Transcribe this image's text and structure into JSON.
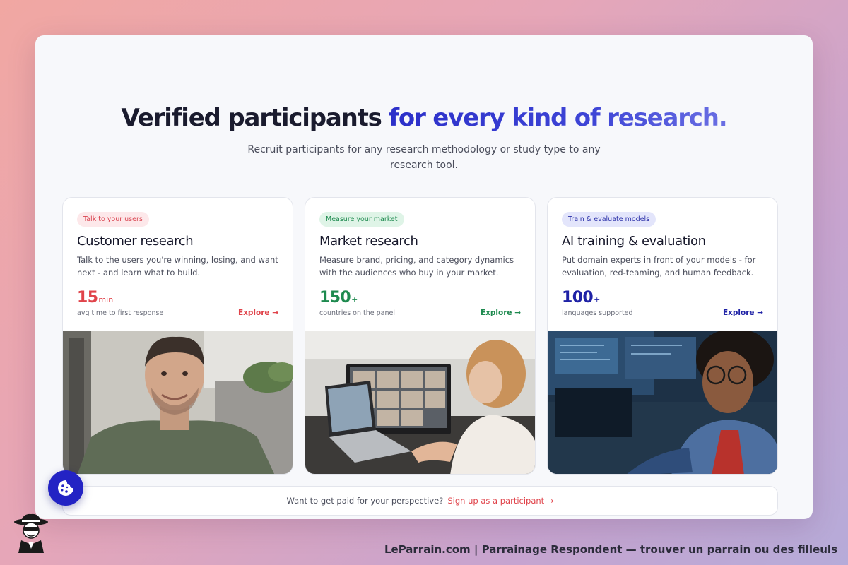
{
  "headline": {
    "part1": "Verified participants ",
    "accent": "for every kind of research."
  },
  "subhead": "Recruit participants for any research methodology or study type to any research tool.",
  "cards": [
    {
      "tag": "Talk to your users",
      "title": "Customer research",
      "description": "Talk to the users you're winning, losing, and want next - and learn what to build.",
      "stat_value": "15",
      "stat_unit": "min",
      "stat_label": "avg time to first response",
      "link": "Explore →",
      "accent_color": "#e0434a"
    },
    {
      "tag": "Measure your market",
      "title": "Market research",
      "description": "Measure brand, pricing, and category dynamics with the audiences who buy in your market.",
      "stat_value": "150",
      "stat_unit": "+",
      "stat_label": "countries on the panel",
      "link": "Explore →",
      "accent_color": "#1e8a4f"
    },
    {
      "tag": "Train & evaluate models",
      "title": "AI training & evaluation",
      "description": "Put domain experts in front of your models - for evaluation, red-teaming, and human feedback.",
      "stat_value": "100",
      "stat_unit": "+",
      "stat_label": "languages supported",
      "link": "Explore →",
      "accent_color": "#1f22a6"
    }
  ],
  "footer": {
    "prompt": "Want to get paid for your perspective?",
    "signup": "Sign up as a participant →"
  },
  "cookie_button": {
    "icon": "cookie-icon"
  },
  "watermark": "LeParrain.com | Parrainage Respondent — trouver un parrain ou des filleuls"
}
